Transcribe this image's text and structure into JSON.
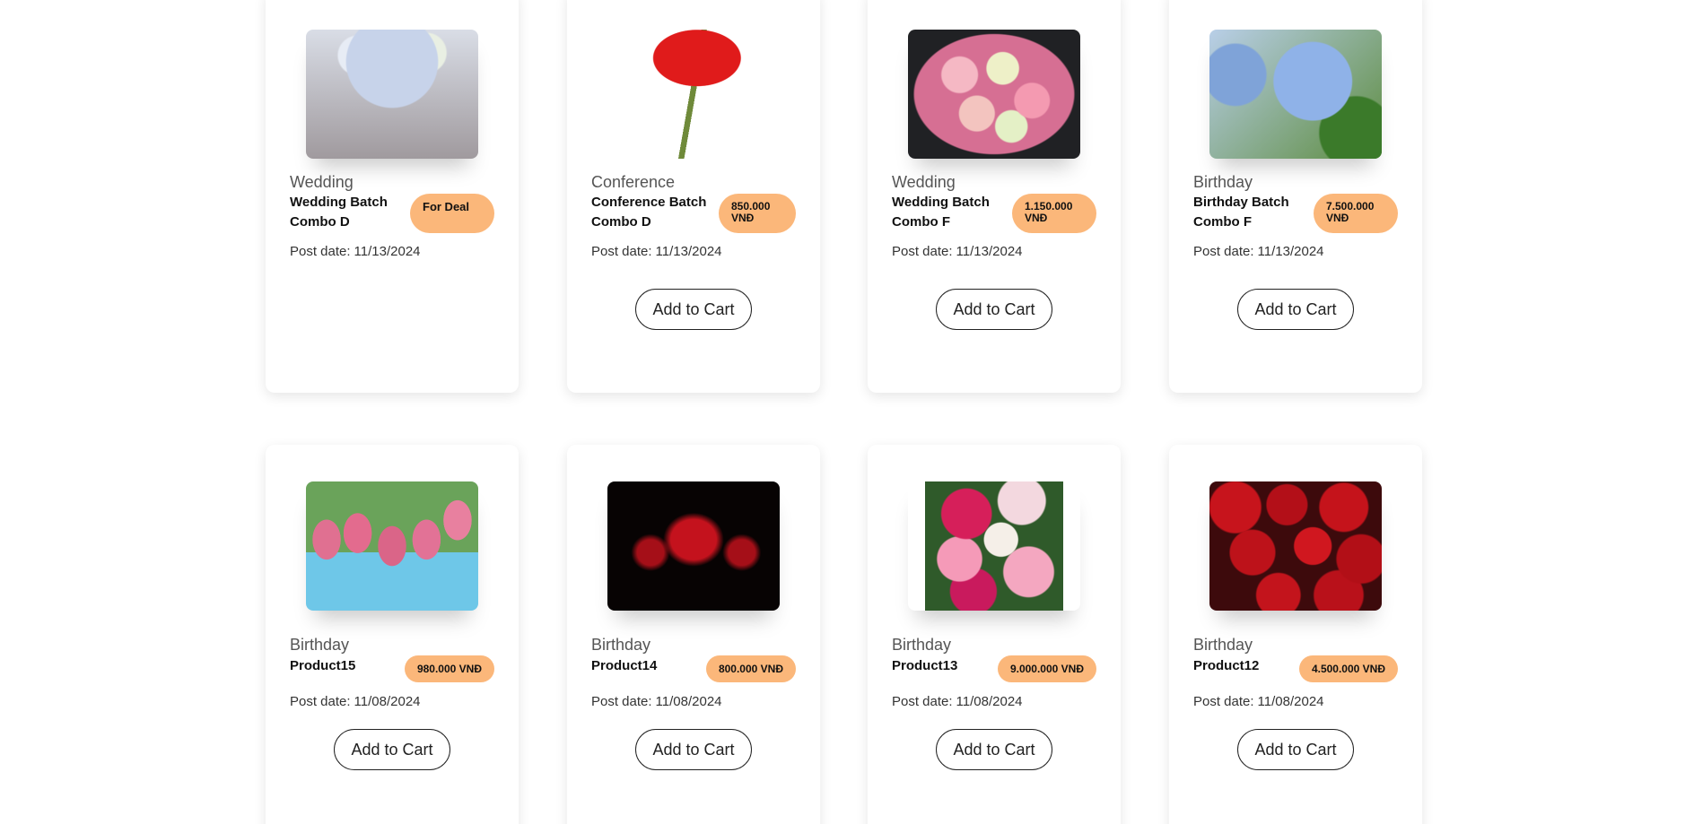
{
  "labels": {
    "post_date": "Post date:",
    "add_to_cart": "Add to Cart"
  },
  "products": [
    {
      "category": "Wedding",
      "name": "Wedding Batch Combo D",
      "price": "For Deal",
      "post_date": "11/13/2024",
      "has_cart_button": false,
      "image_icon": "hydrangea-wedding-centerpiece-image"
    },
    {
      "category": "Conference",
      "name": "Conference Batch Combo D",
      "price": "850.000 VNĐ",
      "post_date": "11/13/2024",
      "has_cart_button": true,
      "image_icon": "red-rose-image"
    },
    {
      "category": "Wedding",
      "name": "Wedding Batch Combo F",
      "price": "1.150.000 VNĐ",
      "post_date": "11/13/2024",
      "has_cart_button": true,
      "image_icon": "mixed-bouquet-image"
    },
    {
      "category": "Birthday",
      "name": "Birthday Batch Combo F",
      "price": "7.500.000 VNĐ",
      "post_date": "11/13/2024",
      "has_cart_button": true,
      "image_icon": "blue-hydrangea-image"
    },
    {
      "category": "Birthday",
      "name": "Product15",
      "price": "980.000 VNĐ",
      "post_date": "11/08/2024",
      "has_cart_button": true,
      "image_icon": "pink-tulips-image"
    },
    {
      "category": "Birthday",
      "name": "Product14",
      "price": "800.000 VNĐ",
      "post_date": "11/08/2024",
      "has_cart_button": true,
      "image_icon": "red-spider-lily-image"
    },
    {
      "category": "Birthday",
      "name": "Product13",
      "price": "9.000.000 VNĐ",
      "post_date": "11/08/2024",
      "has_cart_button": true,
      "image_icon": "peonies-image"
    },
    {
      "category": "Birthday",
      "name": "Product12",
      "price": "4.500.000 VNĐ",
      "post_date": "11/08/2024",
      "has_cart_button": true,
      "image_icon": "red-roses-image"
    }
  ],
  "colors": {
    "price_badge": "#fbb77a",
    "card_bg": "#ffffff",
    "text": "#222222"
  }
}
